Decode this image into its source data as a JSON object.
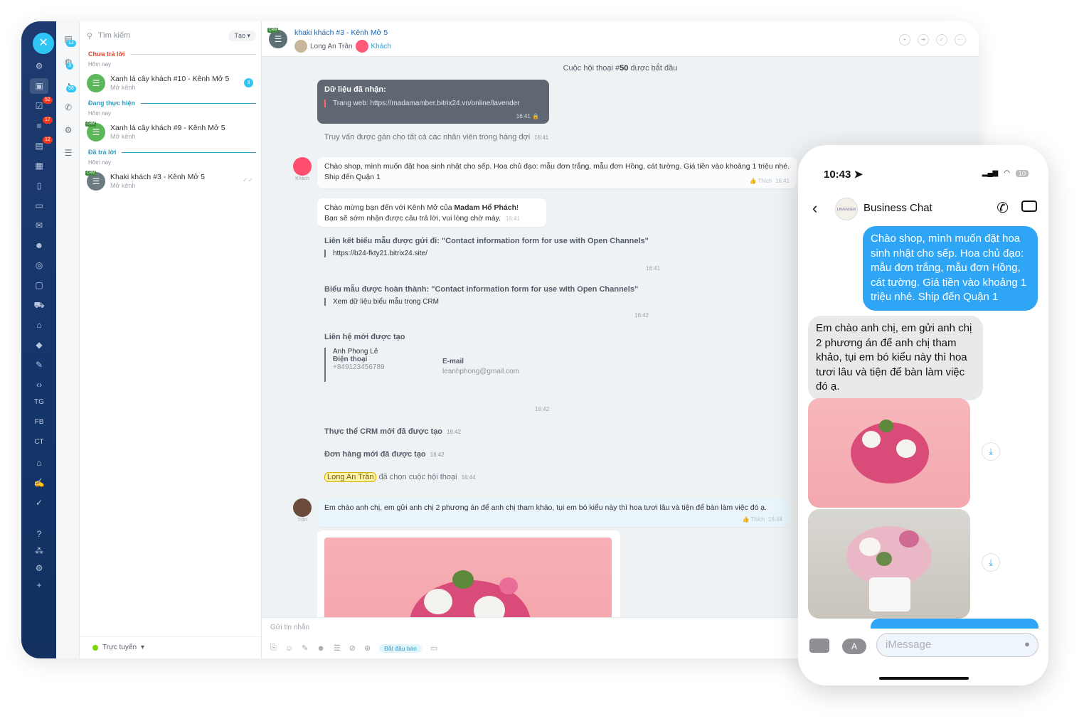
{
  "rail": {
    "items": [
      "TG",
      "FB",
      "CT"
    ],
    "badges": [
      "52",
      "17",
      "12"
    ]
  },
  "col2": {
    "badges": [
      "12",
      "3",
      "58"
    ]
  },
  "list": {
    "search_placeholder": "Tìm kiếm",
    "create_label": "Tạo",
    "sections": [
      {
        "title": "Chưa trả lời",
        "date": "Hôm nay",
        "color": "#e4432a",
        "items": [
          {
            "name": "Xanh lá cây khách #10 - Kênh Mở 5",
            "sub": "Mở kênh",
            "count": "3"
          }
        ]
      },
      {
        "title": "Đang thực hiện",
        "date": "Hôm nay",
        "color": "#2f9ec4",
        "items": [
          {
            "name": "Xanh lá cây khách #9 - Kênh Mở 5",
            "sub": "Mở kênh",
            "badge": "CRM"
          }
        ]
      },
      {
        "title": "Đã trả lời",
        "date": "Hôm nay",
        "color": "#2f9ec4",
        "items": [
          {
            "name": "Khaki khách #3 - Kênh Mở 5",
            "sub": "Mở kênh",
            "badge": "CRM"
          }
        ]
      }
    ],
    "status": "Trực tuyến"
  },
  "header": {
    "badge": "CRM",
    "title": "khaki khách #3 - Kênh Mở 5",
    "user": "Long An Trần",
    "guest": "Khách"
  },
  "messages": {
    "started_prefix": "Cuộc hội thoại #",
    "started_num": "50",
    "started_suffix": " được bắt đầu",
    "data_received_title": "Dữ liệu đã nhận:",
    "data_received_url": "Trang web: https://madamamber.bitrix24.vn/online/lavender",
    "data_received_time": "16:41",
    "assigned": "Truy vấn được gán cho tất cả các nhân viên trong hàng đợi",
    "assigned_time": "16:41",
    "client_msg_1": "Chào shop, mình muốn đặt hoa sinh nhật cho sếp. Hoa chủ đạo: mẫu đơn trắng, mẫu đơn Hồng, cát tường. Giá tiền vào khoảng 1 triệu nhé. Ship đến Quận 1",
    "client_label": "Khách",
    "like": "Thích",
    "client_msg_1_time": "16:41",
    "welcome_prefix": "Chào mừng bạn đến với Kênh Mở của ",
    "welcome_name": "Madam Hổ Phách",
    "welcome_suffix": "!",
    "welcome_line2": "Bạn sẽ sớm nhận được câu trả lời, vui lòng chờ máy.",
    "welcome_time": "16:41",
    "form_sent_title": "Liên kết biểu mẫu được gửi đi: \"Contact information form for use with Open Channels\"",
    "form_sent_link": "https://b24-fkty21.bitrix24.site/",
    "form_sent_time": "16:41",
    "form_done_title": "Biểu mẫu được hoàn thành: \"Contact information form for use with Open Channels\"",
    "form_done_link": "Xem dữ liệu biểu mẫu trong CRM",
    "form_done_time": "16:42",
    "contact_title": "Liên hệ mới được tạo",
    "contact_name": "Anh Phong Lê",
    "contact_phone_label": "Điện thoại",
    "contact_phone": "+849123456789",
    "contact_email_label": "E-mail",
    "contact_email": "leanhphong@gmail.com",
    "contact_time": "16:42",
    "crm_card": "Thực thể CRM mới đã được tạo",
    "crm_card_time": "16:42",
    "order": "Đơn hàng mới đã được tạo",
    "order_time": "16:42",
    "chose_name": "Long An Trần",
    "chose_text": "đã chọn cuộc hội thoại",
    "chose_time": "16:44",
    "agent_msg": "Em chào anh chị, em gửi anh chị 2 phương án để anh chị tham khảo, tụi em bó kiểu này thì hoa tươi lâu và tiện để bàn làm việc đó ạ.",
    "agent_label": "Trần",
    "agent_msg_time": "16:44"
  },
  "composer": {
    "placeholder": "Gửi tin nhắn",
    "sell_label": "Bắt đầu bán"
  },
  "phone": {
    "time": "10:43",
    "battery": "10",
    "business": "Business Chat",
    "logo_text": "LAVENDER",
    "out_msg": "Chào shop, mình muốn đặt hoa sinh nhật cho sếp. Hoa chủ đạo: mẫu đơn trắng, mẫu đơn Hồng, cát tường. Giá tiền vào khoảng 1 triệu nhé. Ship đến Quận 1",
    "in_msg": "Em chào anh chị, em gửi anh chị 2 phương án để anh chị tham khảo, tụi em bó kiểu này thì hoa tươi lâu và tiện để bàn làm việc đó ạ.",
    "input_placeholder": "iMessage"
  }
}
